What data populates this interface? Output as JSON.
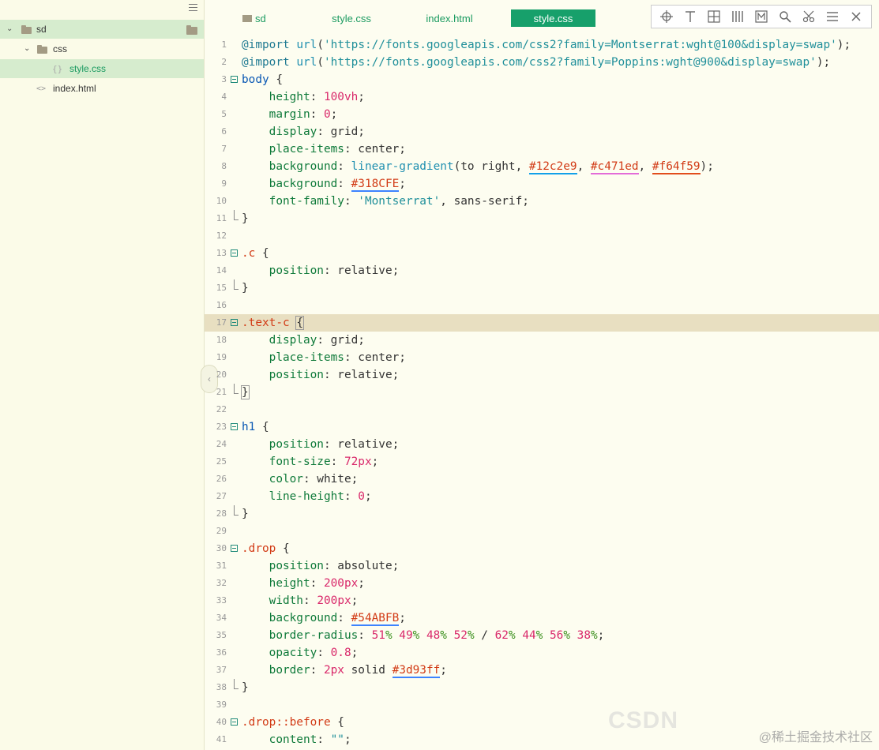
{
  "sidebar": {
    "items": [
      {
        "label": "sd",
        "type": "folder",
        "expanded": true,
        "selected": true
      },
      {
        "label": "css",
        "type": "folder",
        "expanded": true
      },
      {
        "label": "style.css",
        "type": "css-file",
        "selected": true
      },
      {
        "label": "index.html",
        "type": "html-file"
      }
    ]
  },
  "tabs": [
    {
      "label": "sd",
      "icon": "folder-icon"
    },
    {
      "label": "style.css"
    },
    {
      "label": "index.html"
    },
    {
      "label": "style.css",
      "active": true
    }
  ],
  "toolbar": {
    "icons": [
      "crosshair-icon",
      "text-tool-icon",
      "grid-icon",
      "columns-icon",
      "markdown-icon",
      "search-icon",
      "scissors-icon",
      "menu-icon",
      "close-icon"
    ]
  },
  "editor": {
    "highlight_line": 17,
    "lines": [
      {
        "n": "1",
        "code": "@import url('https://fonts.googleapis.com/css2?family=Montserrat:wght@100&display=swap');"
      },
      {
        "n": "2",
        "code": "@import url('https://fonts.googleapis.com/css2?family=Poppins:wght@900&display=swap');"
      },
      {
        "n": "3",
        "code": "body {"
      },
      {
        "n": "4",
        "code": "    height: 100vh;"
      },
      {
        "n": "5",
        "code": "    margin: 0;"
      },
      {
        "n": "6",
        "code": "    display: grid;"
      },
      {
        "n": "7",
        "code": "    place-items: center;"
      },
      {
        "n": "8",
        "code": "    background: linear-gradient(to right, #12c2e9, #c471ed, #f64f59);"
      },
      {
        "n": "9",
        "code": "    background: #318CFE;"
      },
      {
        "n": "10",
        "code": "    font-family: 'Montserrat', sans-serif;"
      },
      {
        "n": "11",
        "code": "}"
      },
      {
        "n": "12",
        "code": ""
      },
      {
        "n": "13",
        "code": ".c {"
      },
      {
        "n": "14",
        "code": "    position: relative;"
      },
      {
        "n": "15",
        "code": "}"
      },
      {
        "n": "16",
        "code": ""
      },
      {
        "n": "17",
        "code": ".text-c {"
      },
      {
        "n": "18",
        "code": "    display: grid;"
      },
      {
        "n": "19",
        "code": "    place-items: center;"
      },
      {
        "n": "20",
        "code": "    position: relative;"
      },
      {
        "n": "21",
        "code": "}"
      },
      {
        "n": "22",
        "code": ""
      },
      {
        "n": "23",
        "code": "h1 {"
      },
      {
        "n": "24",
        "code": "    position: relative;"
      },
      {
        "n": "25",
        "code": "    font-size: 72px;"
      },
      {
        "n": "26",
        "code": "    color: white;"
      },
      {
        "n": "27",
        "code": "    line-height: 0;"
      },
      {
        "n": "28",
        "code": "}"
      },
      {
        "n": "29",
        "code": ""
      },
      {
        "n": "30",
        "code": ".drop {"
      },
      {
        "n": "31",
        "code": "    position: absolute;"
      },
      {
        "n": "32",
        "code": "    height: 200px;"
      },
      {
        "n": "33",
        "code": "    width: 200px;"
      },
      {
        "n": "34",
        "code": "    background: #54ABFB;"
      },
      {
        "n": "35",
        "code": "    border-radius: 51% 49% 48% 52% / 62% 44% 56% 38%;"
      },
      {
        "n": "36",
        "code": "    opacity: 0.8;"
      },
      {
        "n": "37",
        "code": "    border: 2px solid #3d93ff;"
      },
      {
        "n": "38",
        "code": "}"
      },
      {
        "n": "39",
        "code": ""
      },
      {
        "n": "40",
        "code": ".drop::before {"
      },
      {
        "n": "41",
        "code": "    content: \"\";"
      }
    ]
  },
  "watermark": {
    "text": "@稀土掘金技术社区",
    "logo_text": "CSDN"
  }
}
